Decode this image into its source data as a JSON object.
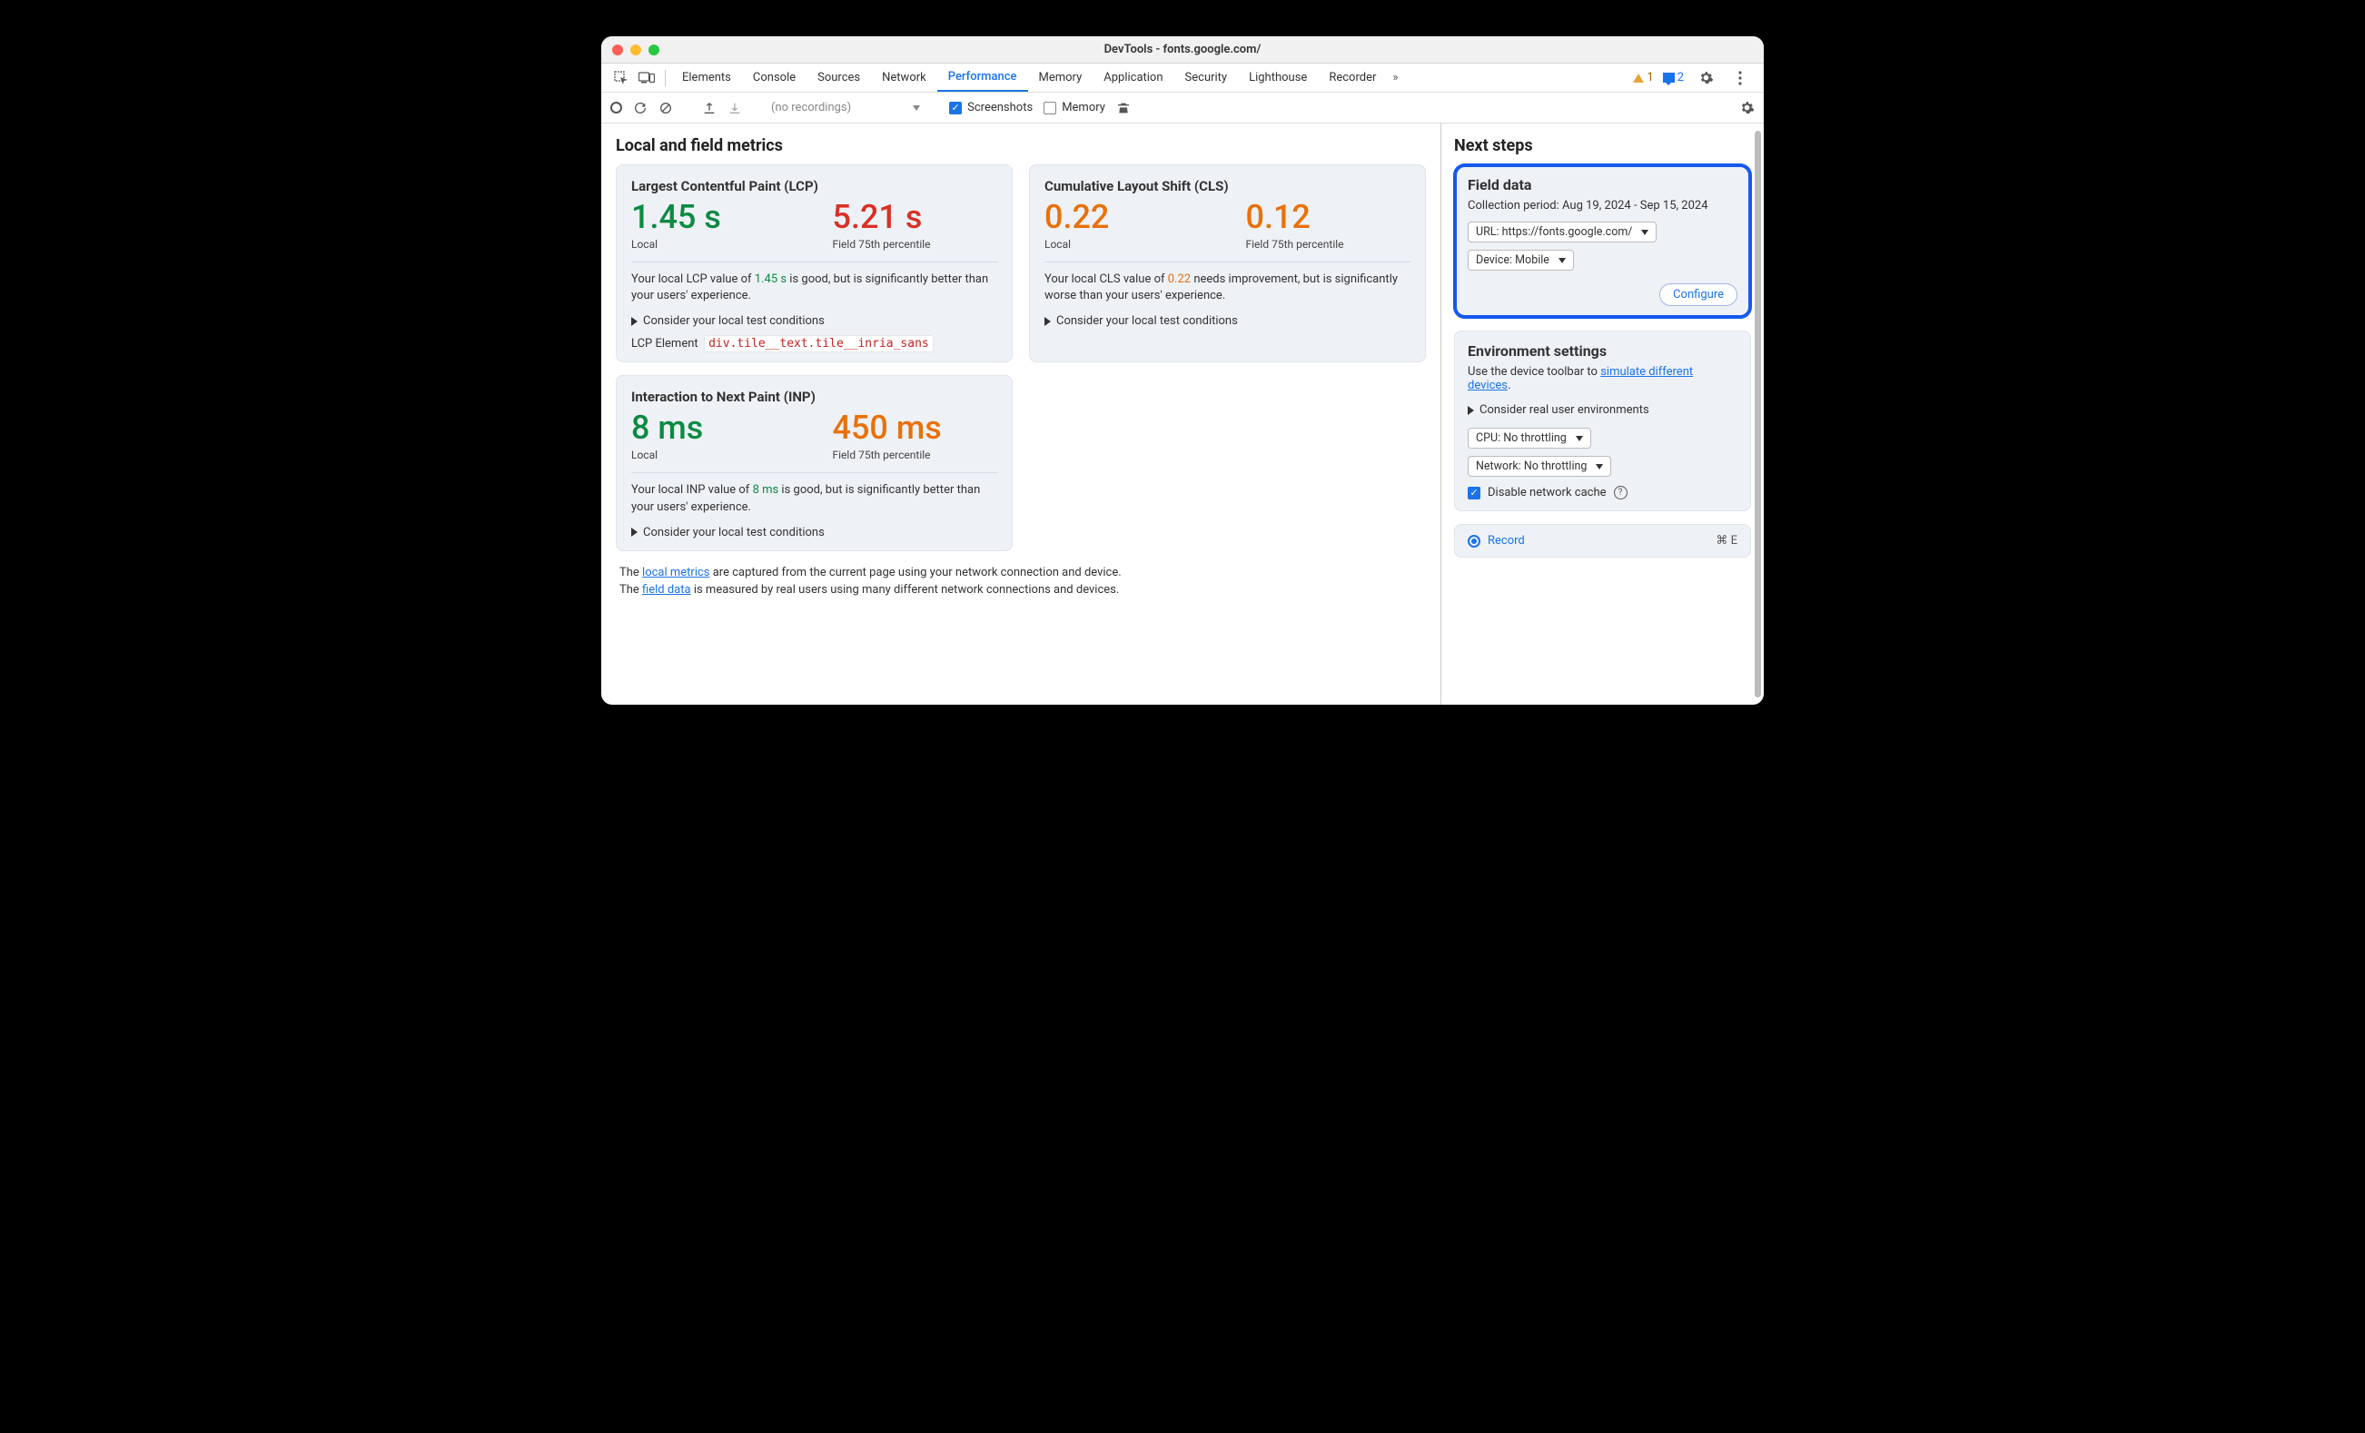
{
  "window": {
    "title": "DevTools - fonts.google.com/"
  },
  "tabs": {
    "items": [
      "Elements",
      "Console",
      "Sources",
      "Network",
      "Performance",
      "Memory",
      "Application",
      "Security",
      "Lighthouse",
      "Recorder"
    ],
    "active": "Performance",
    "overflow_glyph": "»",
    "warn_count": "1",
    "msg_count": "2"
  },
  "toolbar": {
    "recordings_placeholder": "(no recordings)",
    "screenshots_label": "Screenshots",
    "memory_label": "Memory"
  },
  "main_title": "Local and field metrics",
  "lcp": {
    "title": "Largest Contentful Paint (LCP)",
    "local_value": "1.45 s",
    "local_label": "Local",
    "field_value": "5.21 s",
    "field_label": "Field 75th percentile",
    "desc_pre": "Your local LCP value of ",
    "desc_val": "1.45 s",
    "desc_post": " is good, but is significantly better than your users' experience.",
    "expander": "Consider your local test conditions",
    "elem_label": "LCP Element",
    "elem_selector": "div.tile__text.tile__inria_sans"
  },
  "cls": {
    "title": "Cumulative Layout Shift (CLS)",
    "local_value": "0.22",
    "local_label": "Local",
    "field_value": "0.12",
    "field_label": "Field 75th percentile",
    "desc_pre": "Your local CLS value of ",
    "desc_val": "0.22",
    "desc_post": " needs improvement, but is significantly worse than your users' experience.",
    "expander": "Consider your local test conditions"
  },
  "inp": {
    "title": "Interaction to Next Paint (INP)",
    "local_value": "8 ms",
    "local_label": "Local",
    "field_value": "450 ms",
    "field_label": "Field 75th percentile",
    "desc_pre": "Your local INP value of ",
    "desc_val": "8 ms",
    "desc_post": " is good, but is significantly better than your users' experience.",
    "expander": "Consider your local test conditions"
  },
  "footnote": {
    "line1_pre": "The ",
    "line1_link": "local metrics",
    "line1_post": " are captured from the current page using your network connection and device.",
    "line2_pre": "The ",
    "line2_link": "field data",
    "line2_post": " is measured by real users using many different network connections and devices."
  },
  "side_title": "Next steps",
  "field_data": {
    "title": "Field data",
    "period_label": "Collection period: ",
    "period_value": "Aug 19, 2024 - Sep 15, 2024",
    "url_label": "URL: https://fonts.google.com/",
    "device_label": "Device: Mobile",
    "configure": "Configure"
  },
  "env": {
    "title": "Environment settings",
    "lead_pre": "Use the device toolbar to ",
    "lead_link": "simulate different devices",
    "lead_post": ".",
    "expander": "Consider real user environments",
    "cpu_label": "CPU: No throttling",
    "net_label": "Network: No throttling",
    "disable_cache": "Disable network cache"
  },
  "record": {
    "label": "Record",
    "shortcut": "⌘ E"
  }
}
